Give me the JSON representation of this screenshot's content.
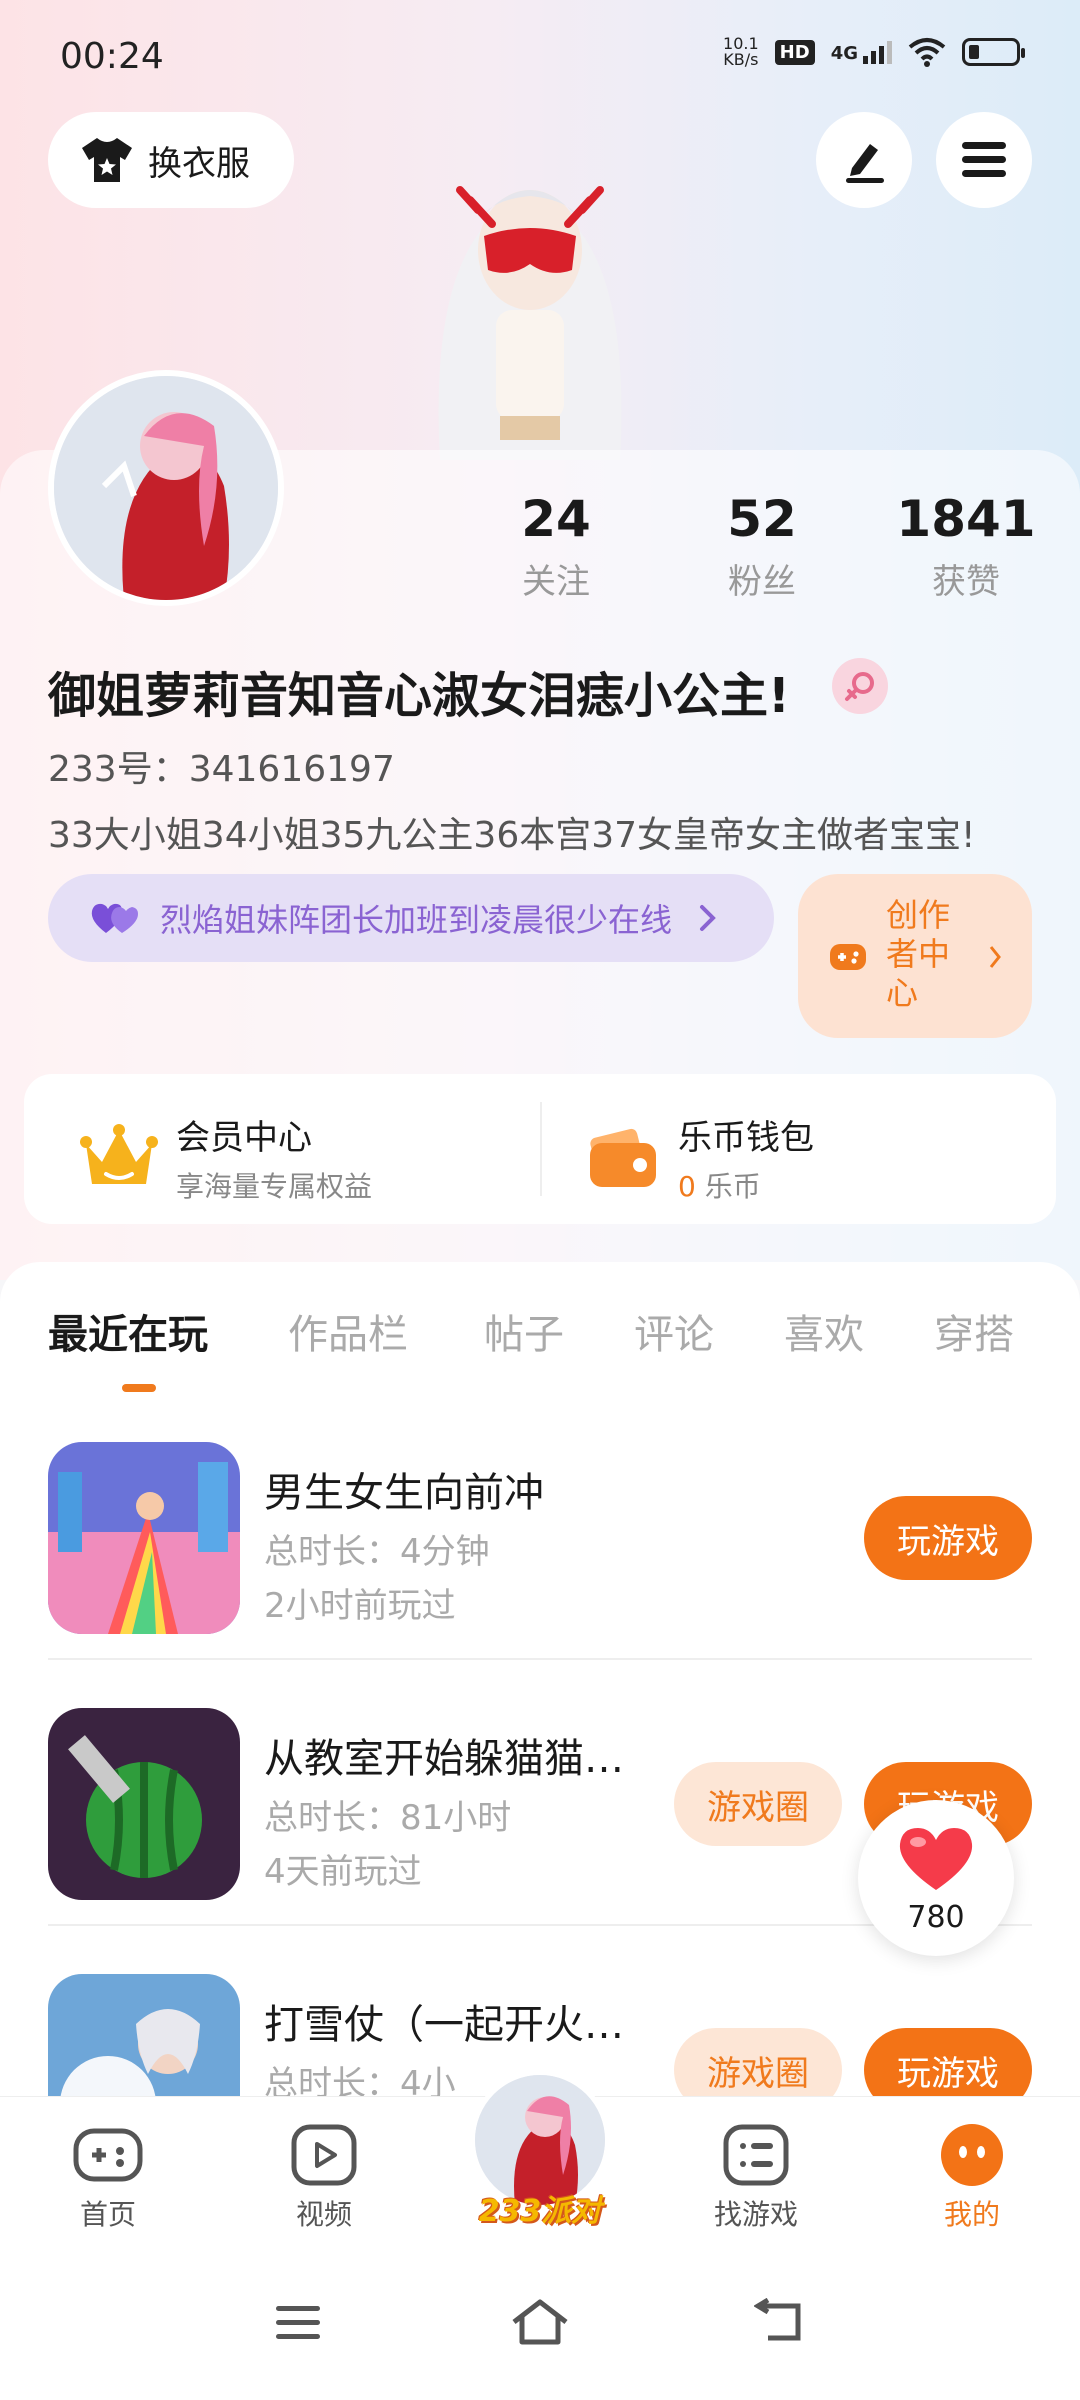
{
  "status_bar": {
    "time": "00:24",
    "net_speed_value": "10.1",
    "net_speed_unit": "KB/s",
    "hd": "HD",
    "network": "4G"
  },
  "header": {
    "outfit_button": "换衣服"
  },
  "stats": [
    {
      "value": "24",
      "label": "关注"
    },
    {
      "value": "52",
      "label": "粉丝"
    },
    {
      "value": "1841",
      "label": "获赞"
    }
  ],
  "profile": {
    "name": "御姐萝莉音知音心淑女泪痣小公主!",
    "uid": "233号：341616197",
    "bio": "33大小姐34小姐35九公主36本宫37女皇帝女主做者宝宝!",
    "group": "烈焰姐妹阵团长加班到凌晨很少在线",
    "creator_center": "创作者中心"
  },
  "wallet": {
    "vip_title": "会员中心",
    "vip_sub": "享海量专属权益",
    "coin_title": "乐币钱包",
    "coin_amount": "0",
    "coin_unit": "乐币"
  },
  "tabs": [
    "最近在玩",
    "作品栏",
    "帖子",
    "评论",
    "喜欢",
    "穿搭"
  ],
  "games": [
    {
      "title": "男生女生向前冲",
      "duration": "总时长：4分钟",
      "last_played": "2小时前玩过",
      "play": "玩游戏"
    },
    {
      "title": "从教室开始躲猫猫…",
      "duration": "总时长：81小时",
      "last_played": "4天前玩过",
      "circle": "游戏圈",
      "play": "玩游戏"
    },
    {
      "title": "打雪仗（一起开火…",
      "duration": "总时长：4小",
      "circle": "游戏圈",
      "play": "玩游戏"
    }
  ],
  "likes": {
    "count": "780"
  },
  "bottom_nav": {
    "home": "首页",
    "video": "视频",
    "party": "233派对",
    "find": "找游戏",
    "mine": "我的"
  },
  "colors": {
    "accent": "#f37316",
    "purple": "#8a63d2"
  }
}
